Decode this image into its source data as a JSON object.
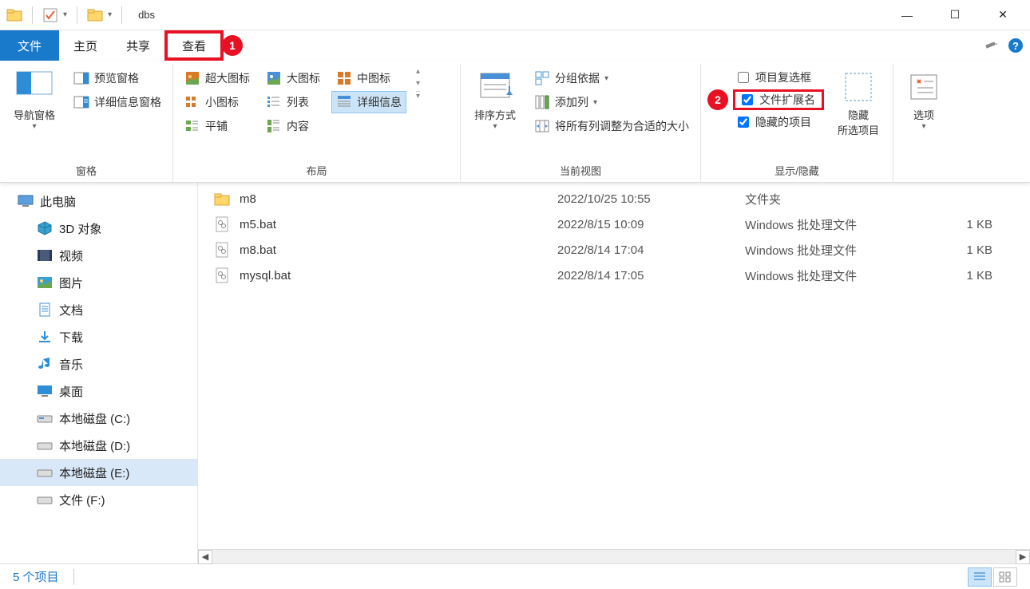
{
  "titlebar": {
    "title": "dbs"
  },
  "win": {
    "min": "—",
    "max": "☐",
    "close": "✕"
  },
  "tabs": {
    "file": "文件",
    "home": "主页",
    "share": "共享",
    "view": "查看"
  },
  "ribbon": {
    "panes": {
      "nav_pane": "导航窗格",
      "preview_pane": "预览窗格",
      "details_pane": "详细信息窗格",
      "group_label": "窗格"
    },
    "layout": {
      "extra_large_icons": "超大图标",
      "large_icons": "大图标",
      "medium_icons": "中图标",
      "small_icons": "小图标",
      "list": "列表",
      "details": "详细信息",
      "tiles": "平铺",
      "content": "内容",
      "group_label": "布局"
    },
    "current_view": {
      "sort_by": "排序方式",
      "group_by": "分组依据",
      "add_columns": "添加列",
      "size_columns": "将所有列调整为合适的大小",
      "group_label": "当前视图"
    },
    "show_hide": {
      "item_checkboxes": "项目复选框",
      "file_ext": "文件扩展名",
      "hidden_items": "隐藏的项目",
      "hide_selected": "隐藏",
      "hide_selected2": "所选项目",
      "group_label": "显示/隐藏"
    },
    "options": {
      "label": "选项"
    }
  },
  "annotations": {
    "one": "1",
    "two": "2"
  },
  "sidebar": {
    "this_pc": "此电脑",
    "objects3d": "3D 对象",
    "videos": "视频",
    "pictures": "图片",
    "documents": "文档",
    "downloads": "下载",
    "music": "音乐",
    "desktop": "桌面",
    "drive_c": "本地磁盘 (C:)",
    "drive_d": "本地磁盘 (D:)",
    "drive_e": "本地磁盘 (E:)",
    "drive_f": "文件 (F:)"
  },
  "files": [
    {
      "name": "m8",
      "date": "2022/10/25 10:55",
      "type": "文件夹",
      "size": ""
    },
    {
      "name": "m5.bat",
      "date": "2022/8/15 10:09",
      "type": "Windows 批处理文件",
      "size": "1 KB"
    },
    {
      "name": "m8.bat",
      "date": "2022/8/14 17:04",
      "type": "Windows 批处理文件",
      "size": "1 KB"
    },
    {
      "name": "mysql.bat",
      "date": "2022/8/14 17:05",
      "type": "Windows 批处理文件",
      "size": "1 KB"
    }
  ],
  "statusbar": {
    "count": "5 个项目"
  }
}
